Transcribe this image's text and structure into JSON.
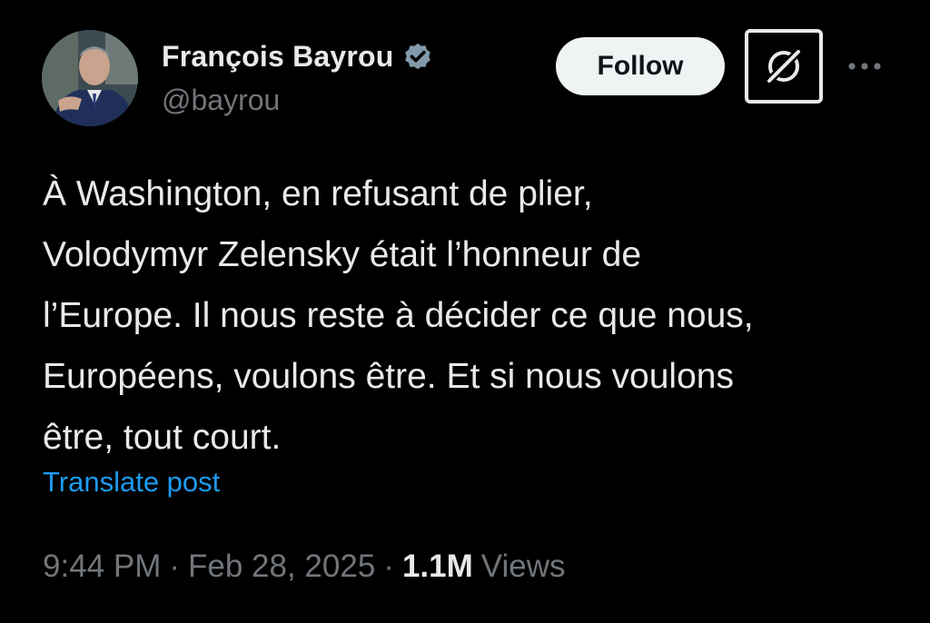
{
  "author": {
    "display_name": "François Bayrou",
    "handle": "@bayrou",
    "verified": true
  },
  "actions": {
    "follow_label": "Follow"
  },
  "post": {
    "lines": [
      "À Washington, en refusant de plier,",
      "Volodymyr Zelensky était l’honneur de",
      "l’Europe. Il nous reste à décider ce que nous,",
      "Européens, voulons être. Et si nous voulons",
      "être, tout court."
    ],
    "translate_label": "Translate post"
  },
  "meta": {
    "time": "9:44 PM",
    "separator": "·",
    "date": "Feb 28, 2025",
    "views_count": "1.1M",
    "views_label": "Views"
  },
  "colors": {
    "background": "#000000",
    "text": "#e7e9ea",
    "secondary": "#71767b",
    "link": "#1d9bf0",
    "follow_bg": "#eff3f4"
  },
  "icons": {
    "verified": "verified-badge-icon",
    "grok": "grok-icon",
    "more": "more-dots-icon"
  }
}
